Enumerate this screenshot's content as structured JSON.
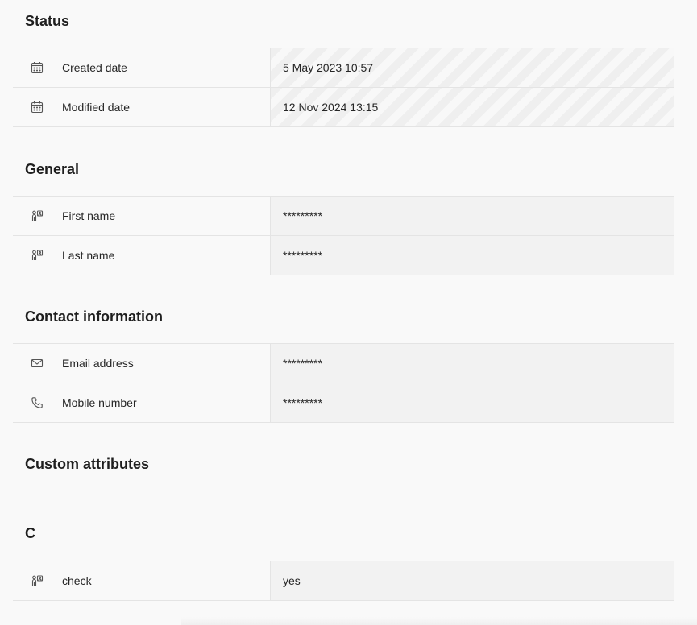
{
  "sections": {
    "status": {
      "title": "Status",
      "rows": [
        {
          "icon": "calendar-icon",
          "label": "Created date",
          "value": "5 May 2023 10:57"
        },
        {
          "icon": "calendar-icon",
          "label": "Modified date",
          "value": "12 Nov 2024 13:15"
        }
      ]
    },
    "general": {
      "title": "General",
      "rows": [
        {
          "icon": "person-id-icon",
          "label": "First name",
          "value": "*********"
        },
        {
          "icon": "person-id-icon",
          "label": "Last name",
          "value": "*********"
        }
      ]
    },
    "contact": {
      "title": "Contact information",
      "rows": [
        {
          "icon": "mail-icon",
          "label": "Email address",
          "value": "*********"
        },
        {
          "icon": "phone-icon",
          "label": "Mobile number",
          "value": "*********"
        }
      ]
    },
    "custom": {
      "title": "Custom attributes"
    },
    "c": {
      "title": "C",
      "rows": [
        {
          "icon": "person-id-icon",
          "label": "check",
          "value": "yes"
        }
      ]
    }
  }
}
